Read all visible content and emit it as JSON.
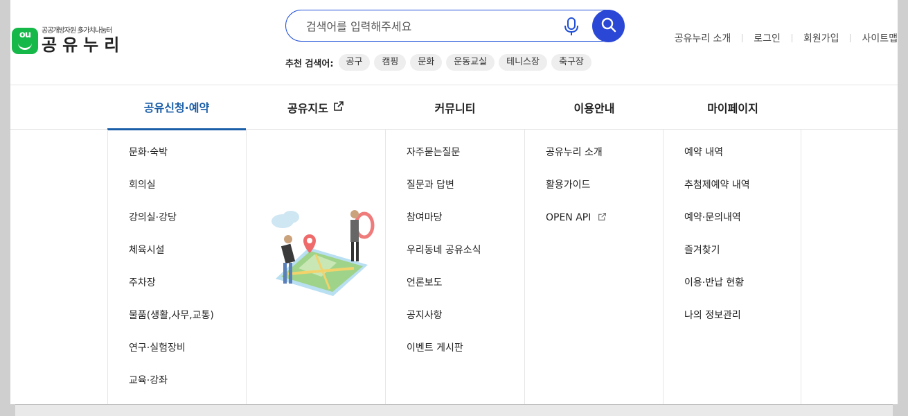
{
  "logo": {
    "badge": "ou",
    "sub": "공공개방자원 多가치나눔터",
    "main": "공유누리"
  },
  "search": {
    "placeholder": "검색어를 입력해주세요"
  },
  "recommend": {
    "label": "추천 검색어:",
    "tags": [
      "공구",
      "캠핑",
      "문화",
      "운동교실",
      "테니스장",
      "축구장"
    ]
  },
  "util_links": [
    "공유누리 소개",
    "로그인",
    "회원가입",
    "사이트맵"
  ],
  "gnb": [
    {
      "label": "공유신청·예약",
      "active": true
    },
    {
      "label": "공유지도",
      "external": true
    },
    {
      "label": "커뮤니티"
    },
    {
      "label": "이용안내"
    },
    {
      "label": "마이페이지"
    }
  ],
  "menus": {
    "reserve": [
      "문화·숙박",
      "회의실",
      "강의실·강당",
      "체육시설",
      "주차장",
      "물품(생활,사무,교통)",
      "연구·실험장비",
      "교육·강좌"
    ],
    "community": [
      "자주묻는질문",
      "질문과 답변",
      "참여마당",
      "우리동네 공유소식",
      "언론보도",
      "공지사항",
      "이벤트 게시판"
    ],
    "guide": [
      "공유누리 소개",
      "활용가이드",
      "OPEN API"
    ],
    "mypage": [
      "예약 내역",
      "추첨제예약 내역",
      "예약·문의내역",
      "즐겨찾기",
      "이용·반납 현황",
      "나의 정보관리"
    ]
  },
  "colors": {
    "accent": "#1a5ea8",
    "search_button": "#2b47d6",
    "logo_green": "#17b84a"
  },
  "icons": [
    "mic-icon",
    "search-icon",
    "external-link-icon",
    "map-illustration"
  ]
}
